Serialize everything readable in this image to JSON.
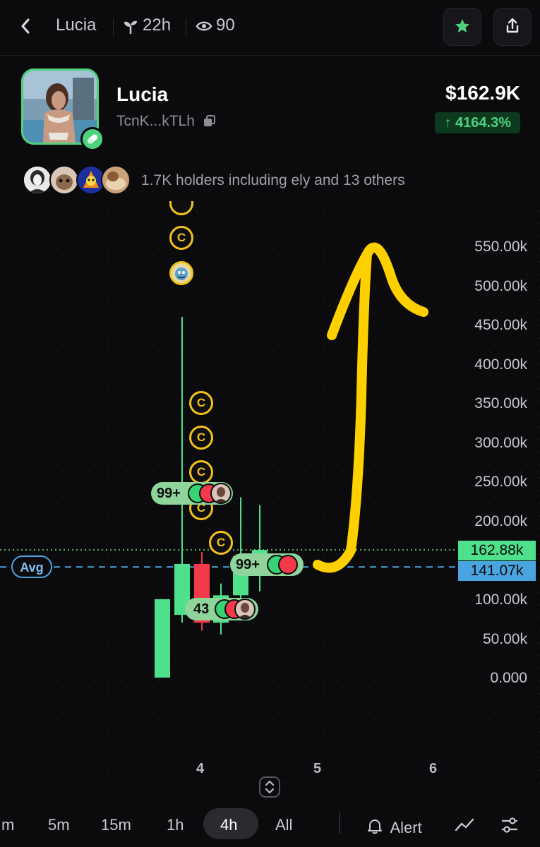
{
  "header": {
    "back_icon": "chevron-left-icon",
    "title": "Lucia",
    "age_icon": "sprout-icon",
    "age": "22h",
    "views_icon": "eye-icon",
    "views": "90",
    "favorite_icon": "star-icon",
    "share_icon": "share-icon",
    "accent": "#4ed27c"
  },
  "token": {
    "name": "Lucia",
    "address": "TcnK...kTLh",
    "copy_icon": "copy-icon",
    "badge_icon": "pill-icon",
    "price": "$162.9K",
    "change": "↑ 4164.3%",
    "change_color": "#4ed27c"
  },
  "holders": {
    "text": "1.7K holders including ely and 13 others"
  },
  "chart": {
    "y_ticks": [
      "550.00k",
      "500.00k",
      "450.00k",
      "400.00k",
      "350.00k",
      "300.00k",
      "250.00k",
      "200.00k",
      "150.00k",
      "100.00k",
      "50.00k",
      "0.000"
    ],
    "x_ticks": [
      "4",
      "5",
      "6"
    ],
    "last_price_label": "162.88k",
    "avg_price_label": "141.07k",
    "avg_label": "Avg",
    "up_color": "#4ee08a",
    "down_color": "#f23a4a",
    "avg_color": "#4aa4e0",
    "coin_symbol": "C",
    "trade_pills": [
      {
        "count": "99+"
      },
      {
        "count": "99+"
      },
      {
        "count": "43"
      }
    ],
    "annotation_color": "#ffd000"
  },
  "chart_data": {
    "type": "candlestick",
    "candles": [
      {
        "open": 0,
        "high": 100,
        "low": 0,
        "close": 100,
        "direction": "up"
      },
      {
        "open": 80,
        "high": 460,
        "low": 70,
        "close": 145,
        "direction": "up"
      },
      {
        "open": 145,
        "high": 160,
        "low": 60,
        "close": 70,
        "direction": "down"
      },
      {
        "open": 70,
        "high": 120,
        "low": 55,
        "close": 105,
        "direction": "up"
      },
      {
        "open": 105,
        "high": 230,
        "low": 90,
        "close": 155,
        "direction": "up"
      },
      {
        "open": 155,
        "high": 220,
        "low": 110,
        "close": 162.88,
        "direction": "up"
      }
    ],
    "ylim": [
      0,
      560
    ],
    "y_unit": "k",
    "last_price": 162.88,
    "avg_price": 141.07
  },
  "timeframes": {
    "options": [
      "m",
      "5m",
      "15m",
      "1h",
      "4h",
      "All"
    ],
    "selected": "4h",
    "alert_label": "Alert",
    "alert_icon": "bell-icon",
    "chart_type_icon": "line-chart-icon",
    "settings_icon": "sliders-icon",
    "expand_icon": "expand-chevrons-icon"
  }
}
